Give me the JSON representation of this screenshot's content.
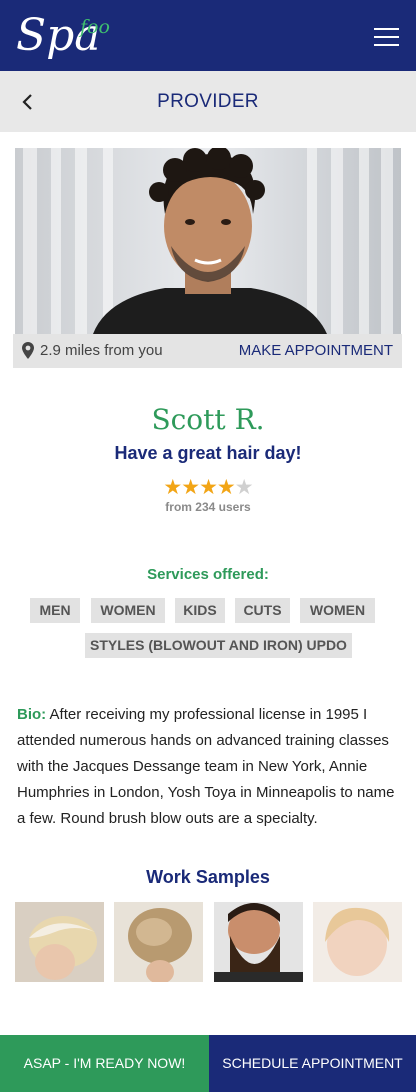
{
  "app": {
    "logo_main": "Spa",
    "logo_sub": "foo"
  },
  "header": {
    "title": "PROVIDER"
  },
  "provider": {
    "distance": "2.9 miles from you",
    "make_appointment": "MAKE APPOINTMENT",
    "name": "Scott R.",
    "tagline": "Have a great hair day!",
    "rating": 4,
    "rating_max": 5,
    "rating_count": "from 234 users"
  },
  "services": {
    "title": "Services offered:",
    "tags": [
      "MEN",
      "WOMEN",
      "KIDS",
      "CUTS",
      "WOMEN",
      "STYLES (BLOWOUT AND IRON) UPDO"
    ]
  },
  "bio": {
    "label": "Bio:",
    "text": "After receiving my professional license in 1995 I attended numerous hands on advanced training classes with the Jacques Dessange  team in New York, Annie Humphries in London, Yosh Toya in Minneapolis to name a few. Round brush blow outs are a specialty."
  },
  "samples": {
    "title": "Work Samples"
  },
  "actions": {
    "asap": "ASAP - I'M READY NOW!",
    "schedule": "SCHEDULE APPOINTMENT"
  },
  "colors": {
    "brand_navy": "#1a2a78",
    "brand_green": "#2e9a5a",
    "star": "#f2a516"
  }
}
